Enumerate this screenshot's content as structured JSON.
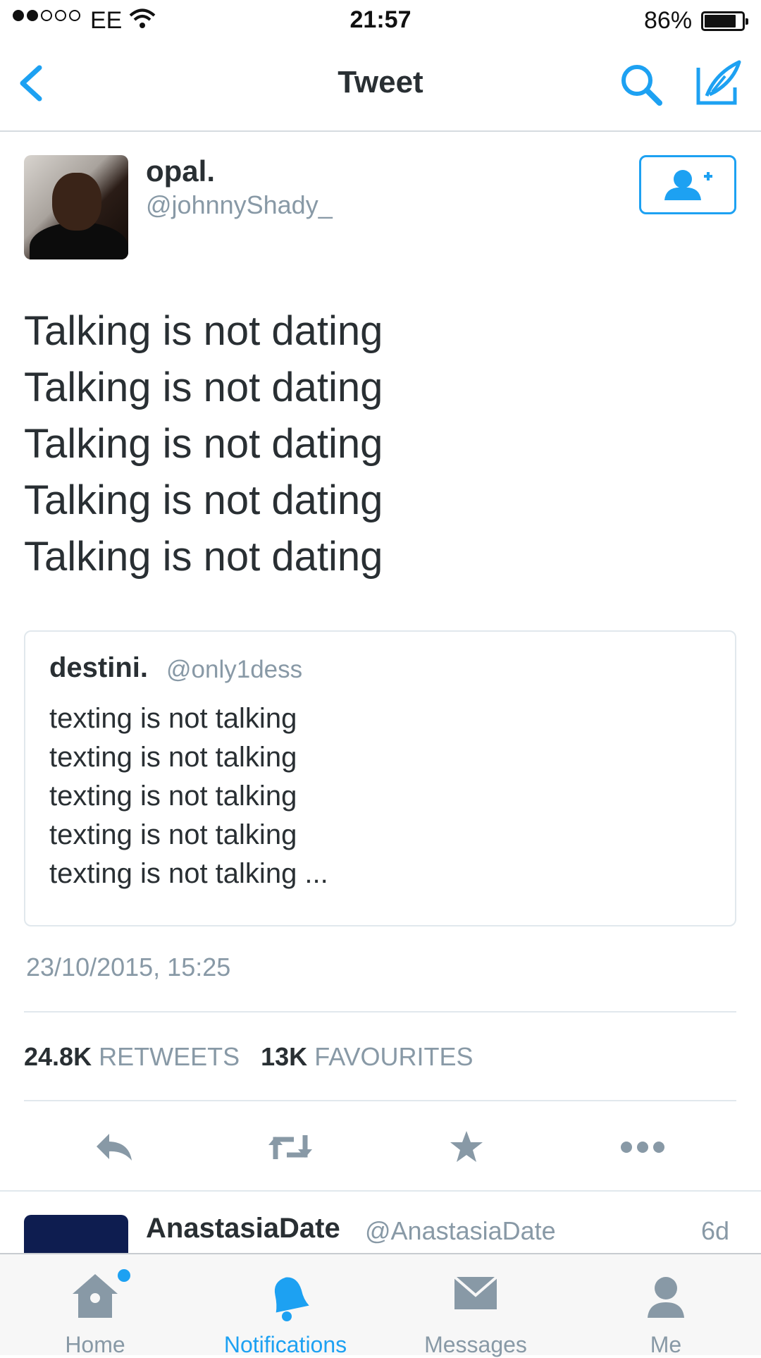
{
  "status_bar": {
    "carrier": "EE",
    "time": "21:57",
    "battery": "86%"
  },
  "nav": {
    "title": "Tweet"
  },
  "tweet": {
    "name": "opal.",
    "handle": "@johnnyShady_",
    "lines": [
      "Talking is not dating",
      "Talking is not dating",
      "Talking is not dating",
      "Talking is not dating",
      "Talking is not dating"
    ],
    "quoted": {
      "name": "destini.",
      "handle": "@only1dess",
      "lines": [
        "texting is not talking",
        "texting is not talking",
        "texting is not talking",
        "texting is not talking",
        "texting is not talking ..."
      ]
    },
    "timestamp": "23/10/2015, 15:25",
    "retweets_count": "24.8K",
    "retweets_label": "RETWEETS",
    "favourites_count": "13K",
    "favourites_label": "FAVOURITES"
  },
  "next_tweet": {
    "name": "AnastasiaDate",
    "handle": "@AnastasiaDate",
    "time": "6d"
  },
  "tabs": [
    {
      "label": "Home",
      "icon": "home-icon"
    },
    {
      "label": "Notifications",
      "icon": "bell-icon"
    },
    {
      "label": "Messages",
      "icon": "envelope-icon"
    },
    {
      "label": "Me",
      "icon": "person-icon"
    }
  ],
  "colors": {
    "accent": "#1da1f2",
    "text": "#292f33",
    "muted": "#8899a6"
  }
}
